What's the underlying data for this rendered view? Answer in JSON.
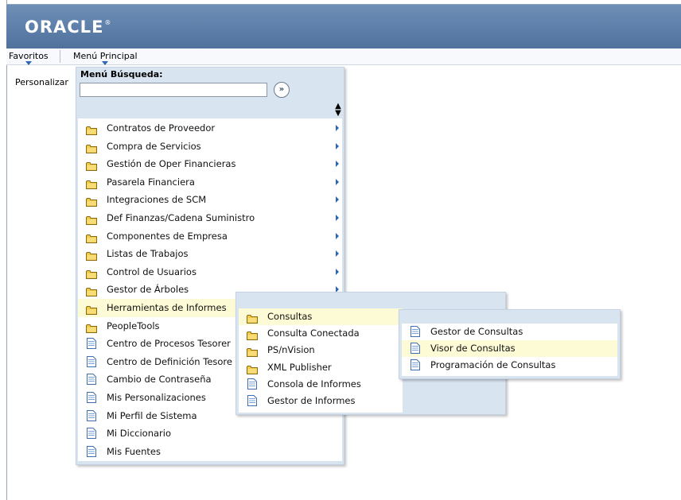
{
  "header": {
    "logo_text": "ORACLE",
    "logo_tm": "®"
  },
  "menubar": {
    "favoritos": "Favoritos",
    "menu_principal": "Menú Principal"
  },
  "page": {
    "personalizar": "Personalizar"
  },
  "menu_search": {
    "label": "Menú Búsqueda:",
    "value": "",
    "go_icon": "»"
  },
  "main_menu": {
    "items": [
      {
        "label": "Contratos de Proveedor",
        "icon": "folder-icon",
        "has_submenu": true
      },
      {
        "label": "Compra de Servicios",
        "icon": "folder-icon",
        "has_submenu": true
      },
      {
        "label": "Gestión de Oper Financieras",
        "icon": "folder-icon",
        "has_submenu": true
      },
      {
        "label": "Pasarela Financiera",
        "icon": "folder-icon",
        "has_submenu": true
      },
      {
        "label": "Integraciones de SCM",
        "icon": "folder-icon",
        "has_submenu": true
      },
      {
        "label": "Def Finanzas/Cadena Suministro",
        "icon": "folder-icon",
        "has_submenu": true
      },
      {
        "label": "Componentes de Empresa",
        "icon": "folder-icon",
        "has_submenu": true
      },
      {
        "label": "Listas de Trabajos",
        "icon": "folder-icon",
        "has_submenu": true
      },
      {
        "label": "Control de Usuarios",
        "icon": "folder-icon",
        "has_submenu": true
      },
      {
        "label": "Gestor de Árboles",
        "icon": "folder-icon",
        "has_submenu": true
      },
      {
        "label": "Herramientas de Informes",
        "icon": "folder-icon",
        "has_submenu": true,
        "active": true
      },
      {
        "label": "PeopleTools",
        "icon": "folder-icon",
        "has_submenu": false
      },
      {
        "label": "Centro de Procesos Tesorer",
        "icon": "document-icon",
        "has_submenu": false
      },
      {
        "label": "Centro de Definición Tesore",
        "icon": "document-icon",
        "has_submenu": false
      },
      {
        "label": "Cambio de Contraseña",
        "icon": "document-icon",
        "has_submenu": false
      },
      {
        "label": "Mis Personalizaciones",
        "icon": "document-icon",
        "has_submenu": false
      },
      {
        "label": "Mi Perfil de Sistema",
        "icon": "document-icon",
        "has_submenu": false
      },
      {
        "label": "Mi Diccionario",
        "icon": "document-icon",
        "has_submenu": false
      },
      {
        "label": "Mis Fuentes",
        "icon": "document-icon",
        "has_submenu": false
      }
    ]
  },
  "submenu_informes": {
    "items": [
      {
        "label": "Consultas",
        "icon": "folder-icon",
        "active": true
      },
      {
        "label": "Consulta Conectada",
        "icon": "folder-icon"
      },
      {
        "label": "PS/nVision",
        "icon": "folder-icon"
      },
      {
        "label": "XML Publisher",
        "icon": "folder-icon"
      },
      {
        "label": "Consola de Informes",
        "icon": "document-icon"
      },
      {
        "label": "Gestor de Informes",
        "icon": "document-icon"
      }
    ]
  },
  "submenu_consultas": {
    "items": [
      {
        "label": "Gestor de Consultas",
        "icon": "document-icon"
      },
      {
        "label": "Visor de Consultas",
        "icon": "document-icon",
        "active": true
      },
      {
        "label": "Programación de Consultas",
        "icon": "document-icon"
      }
    ]
  },
  "colors": {
    "header": "#5b7da8",
    "menu_bg": "#d9e4f1",
    "highlight": "#fdfbd6",
    "arrow": "#2f66b3"
  }
}
